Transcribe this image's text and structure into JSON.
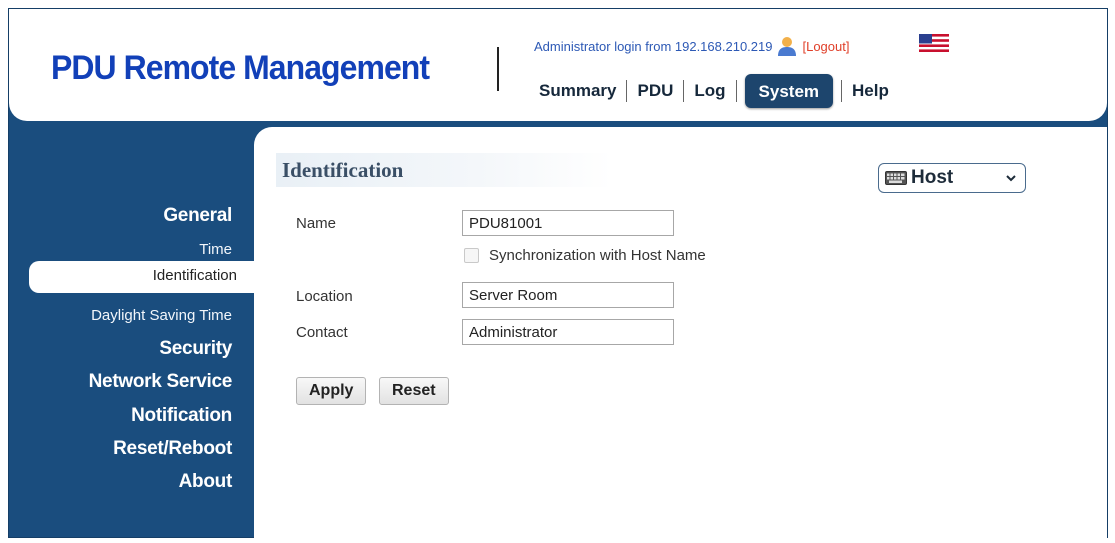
{
  "header": {
    "app_title": "PDU Remote Management",
    "login_text": "Administrator login from 192.168.210.219",
    "logout_label": "[Logout]"
  },
  "nav": {
    "items": [
      {
        "label": "Summary"
      },
      {
        "label": "PDU"
      },
      {
        "label": "Log"
      },
      {
        "label": "System",
        "active": true
      },
      {
        "label": "Help"
      }
    ]
  },
  "sidebar": {
    "items": [
      {
        "label": "General",
        "type": "section"
      },
      {
        "label": "Time",
        "type": "sub"
      },
      {
        "label": "Identification",
        "type": "sub",
        "active": true
      },
      {
        "label": "Daylight Saving Time",
        "type": "sub"
      },
      {
        "label": "Security",
        "type": "section"
      },
      {
        "label": "Network Service",
        "type": "section"
      },
      {
        "label": "Notification",
        "type": "section"
      },
      {
        "label": "Reset/Reboot",
        "type": "section"
      },
      {
        "label": "About",
        "type": "section"
      }
    ]
  },
  "content": {
    "section_title": "Identification",
    "host_select": {
      "selected": "Host"
    },
    "form": {
      "name_label": "Name",
      "name_value": "PDU81001",
      "sync_label": "Synchronization with Host Name",
      "sync_checked": false,
      "location_label": "Location",
      "location_value": "Server Room",
      "contact_label": "Contact",
      "contact_value": "Administrator"
    },
    "buttons": {
      "apply": "Apply",
      "reset": "Reset"
    }
  },
  "colors": {
    "frame": "#1a4d7e",
    "title": "#1240b8",
    "nav_active": "#1d456d",
    "logout": "#e0402a",
    "login_text": "#2d59b5"
  },
  "icons": {
    "user": "user-icon",
    "flag": "us-flag-icon",
    "keyboard": "keyboard-icon",
    "dropdown": "chevron-down-icon"
  }
}
